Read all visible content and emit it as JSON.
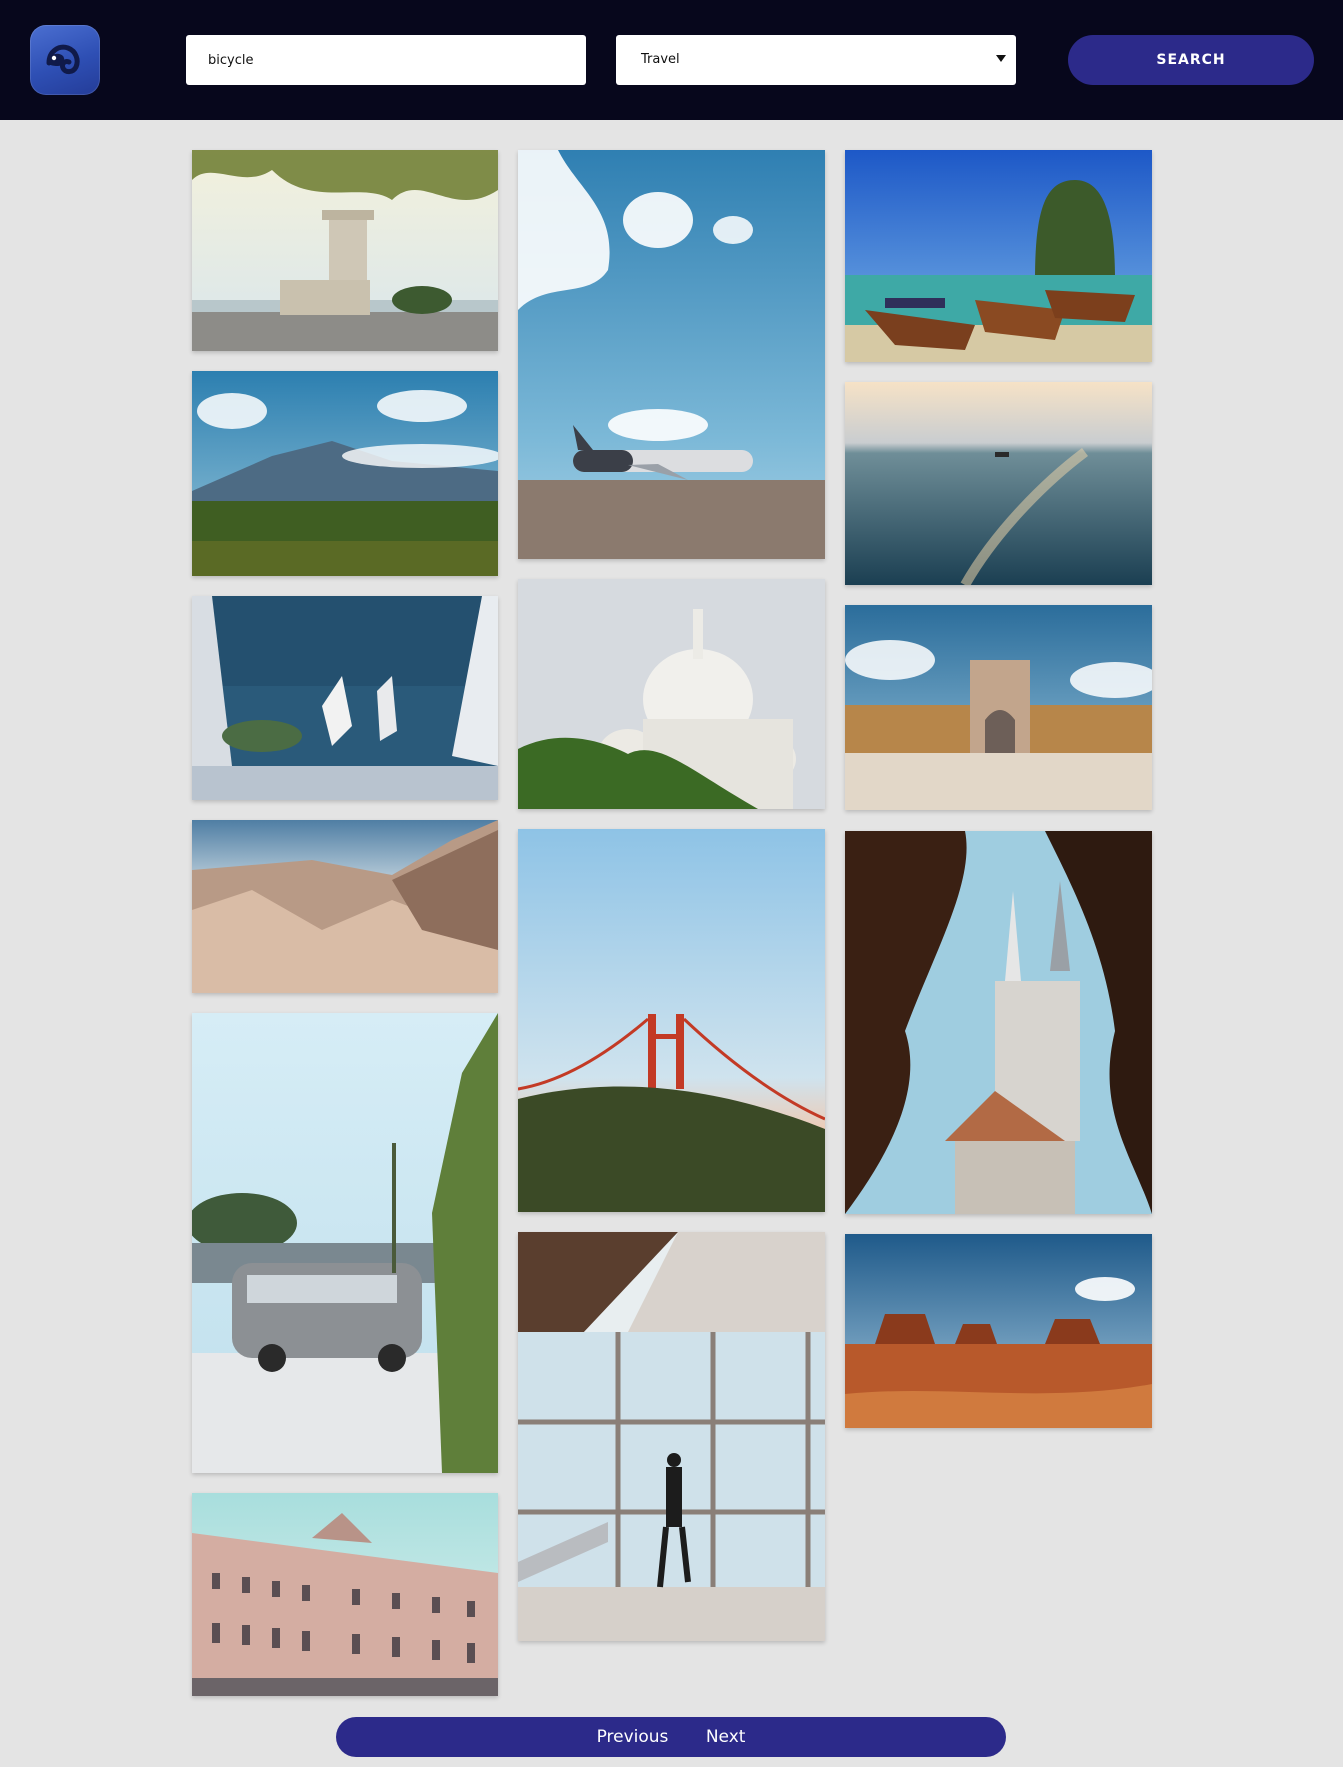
{
  "header": {
    "logo": "chameleon-logo",
    "search": {
      "value": "bicycle",
      "placeholder": ""
    },
    "category": {
      "selected": "Travel"
    },
    "search_button": "SEARCH"
  },
  "gallery": {
    "photos": [
      {
        "subject": "belem-tower"
      },
      {
        "subject": "mountain-valley"
      },
      {
        "subject": "santorini-boats"
      },
      {
        "subject": "desert-badlands"
      },
      {
        "subject": "vintage-van"
      },
      {
        "subject": "baroque-palace"
      },
      {
        "subject": "airplane-runway"
      },
      {
        "subject": "sacre-coeur"
      },
      {
        "subject": "golden-gate-bridge"
      },
      {
        "subject": "airport-window-man"
      },
      {
        "subject": "longtail-boats"
      },
      {
        "subject": "ocean-sunset"
      },
      {
        "subject": "lisbon-arch-square"
      },
      {
        "subject": "cathedral-spires"
      },
      {
        "subject": "monument-valley"
      }
    ]
  },
  "pagination": {
    "previous": "Previous",
    "next": "Next"
  },
  "colors": {
    "header_bg": "#07071c",
    "accent": "#2c2a8a",
    "page_bg": "#e4e4e4"
  }
}
